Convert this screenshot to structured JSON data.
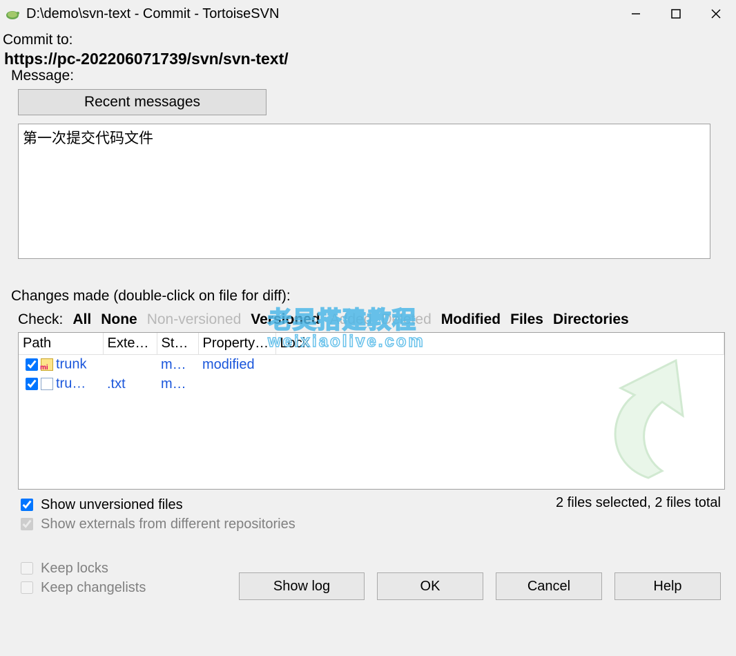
{
  "titlebar": {
    "title": "D:\\demo\\svn-text - Commit - TortoiseSVN"
  },
  "commit": {
    "label": "Commit to:",
    "url": "https://pc-202206071739/svn/svn-text/"
  },
  "message": {
    "legend": "Message:",
    "recent_btn": "Recent messages",
    "text": "第一次提交代码文件"
  },
  "changes": {
    "label": "Changes made (double-click on file for diff):",
    "check_label": "Check:",
    "filters": {
      "all": "All",
      "none": "None",
      "nonversioned": "Non-versioned",
      "versioned": "Versioned",
      "added": "Added",
      "deleted": "Deleted",
      "modified": "Modified",
      "files": "Files",
      "directories": "Directories"
    },
    "columns": {
      "path": "Path",
      "ext": "Exte…",
      "status": "St…",
      "prop": "Property…",
      "lock": "Lock"
    },
    "rows": [
      {
        "checked": true,
        "icon": "folder",
        "path": "trunk",
        "ext": "",
        "status": "m…",
        "prop": "modified",
        "lock": ""
      },
      {
        "checked": true,
        "icon": "txt",
        "path": "tru…",
        "ext": ".txt",
        "status": "m…",
        "prop": "",
        "lock": ""
      }
    ],
    "summary": "2 files selected, 2 files total"
  },
  "options": {
    "show_unversioned": "Show unversioned files",
    "show_externals": "Show externals from different repositories",
    "keep_locks": "Keep locks",
    "keep_changelists": "Keep changelists"
  },
  "buttons": {
    "show_log": "Show log",
    "ok": "OK",
    "cancel": "Cancel",
    "help": "Help"
  },
  "watermark": {
    "line1": "老吴搭建教程",
    "line2": "weixiaolive.com"
  }
}
